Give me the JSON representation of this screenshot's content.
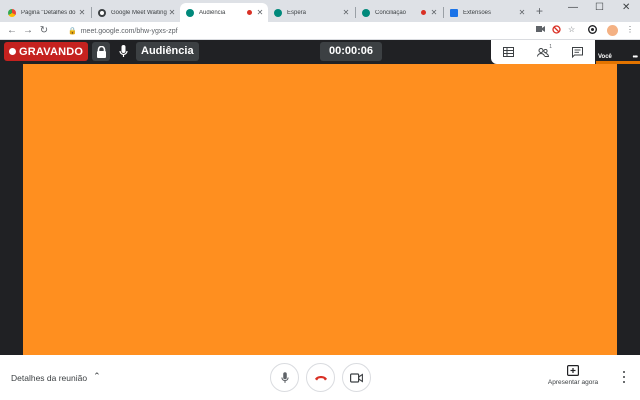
{
  "browser": {
    "tabs": [
      {
        "title": "Página \"Detalhes do",
        "icon": "chrome-rainbow-icon",
        "recording": false,
        "active": false
      },
      {
        "title": "Google Meet Waiting",
        "icon": "meet-icon",
        "recording": false,
        "active": false
      },
      {
        "title": "Audiência",
        "icon": "meet-icon",
        "recording": true,
        "active": true
      },
      {
        "title": "Espera",
        "icon": "meet-icon",
        "recording": false,
        "active": false
      },
      {
        "title": "Conciliação",
        "icon": "meet-icon",
        "recording": true,
        "active": false
      },
      {
        "title": "Extensões",
        "icon": "puzzle-icon",
        "recording": false,
        "active": false
      }
    ],
    "new_tab_label": "+",
    "window_controls": {
      "minimize": "—",
      "maximize": "☐",
      "close": "✕"
    },
    "address_bar": {
      "url": "meet.google.com/bhw-ygxs-zpf"
    }
  },
  "meet": {
    "recording_label": "GRAVANDO",
    "meeting_title": "Audiência",
    "timer": "00:00:06",
    "participants_count": "1",
    "self_name": "Você",
    "self_more": "•••",
    "video_color": "#ff8f1f",
    "bottom": {
      "details_label": "Detalhes da reunião",
      "present_label": "Apresentar agora"
    }
  },
  "colors": {
    "recording": "#c5221f",
    "hangup": "#d93025",
    "background": "#202124"
  }
}
